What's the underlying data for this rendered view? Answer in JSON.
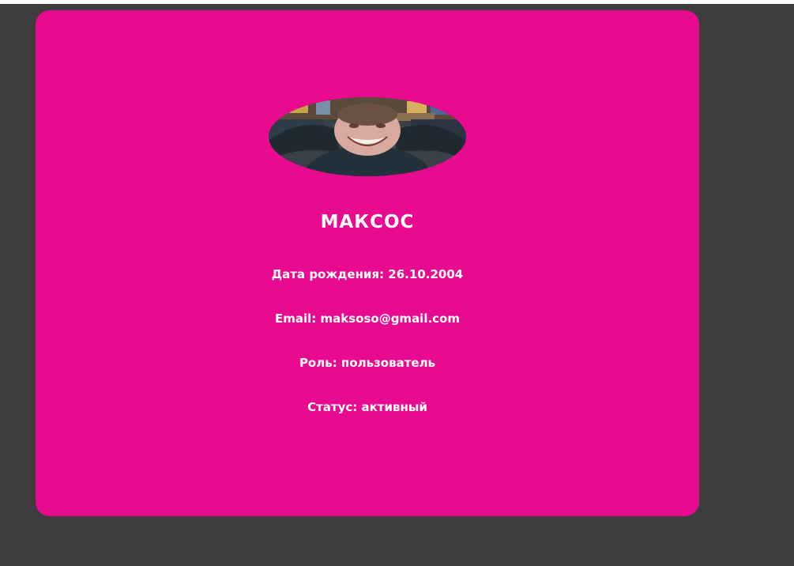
{
  "colors": {
    "background": "#3d3d3d",
    "card": "#e90b8f",
    "text": "#ffffff"
  },
  "profile": {
    "avatar_icon": "user-photo",
    "name": "МАКСОС",
    "birth_date": "Дата рождения: 26.10.2004",
    "email": "Email: maksoso@gmail.com",
    "role": "Роль: пользователь",
    "status": "Статус: активный"
  }
}
